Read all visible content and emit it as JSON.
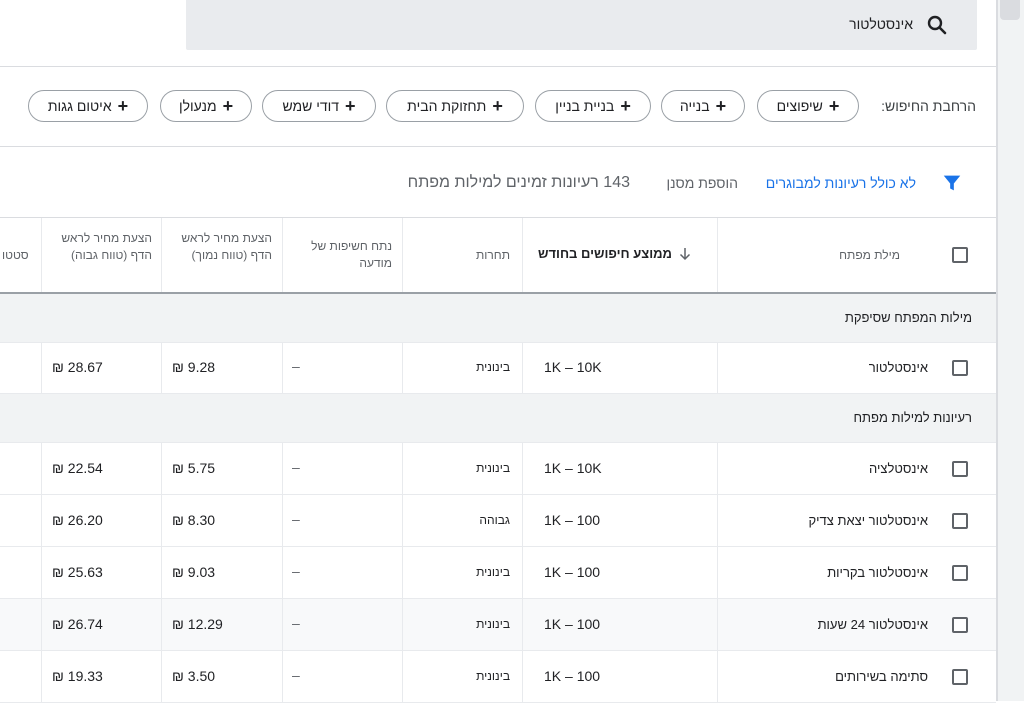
{
  "search": {
    "query": "אינסטלטור"
  },
  "expand": {
    "label": "הרחבת החיפוש:",
    "chips": [
      "שיפוצים",
      "בנייה",
      "בניית בניין",
      "תחזוקת הבית",
      "דודי שמש",
      "מנעולן",
      "איטום גגות"
    ]
  },
  "toolbar": {
    "filter_label": "לא כולל רעיונות למבוגרים",
    "add_filter": "הוספת מסנן",
    "ideas_count": "143 רעיונות זמינים למילות מפתח"
  },
  "columns": {
    "keyword": "מילת מפתח",
    "avg_searches": "ממוצע חיפושים בחודש",
    "competition": "תחרות",
    "impression_share": "נתח חשיפות של מודעה",
    "bid_low": "הצעת מחיר לראש הדף (טווח נמוך)",
    "bid_high": "הצעת מחיר לראש הדף (טווח גבוה)",
    "status_partial": "סטטו"
  },
  "groups": {
    "provided": "מילות המפתח שסיפקת",
    "ideas": "רעיונות למילות מפתח"
  },
  "rows": [
    {
      "keyword": "אינסטלטור",
      "volume": "1K – 10K",
      "competition": "בינונית",
      "share": "–",
      "bid_low": "₪ 9.28",
      "bid_high": "₪ 28.67"
    },
    {
      "keyword": "אינסטלציה",
      "volume": "1K – 10K",
      "competition": "בינונית",
      "share": "–",
      "bid_low": "₪ 5.75",
      "bid_high": "₪ 22.54"
    },
    {
      "keyword": "אינסטלטור יצאת צדיק",
      "volume": "1K – 100",
      "competition": "גבוהה",
      "share": "–",
      "bid_low": "₪ 8.30",
      "bid_high": "₪ 26.20"
    },
    {
      "keyword": "אינסטלטור בקריות",
      "volume": "1K – 100",
      "competition": "בינונית",
      "share": "–",
      "bid_low": "₪ 9.03",
      "bid_high": "₪ 25.63"
    },
    {
      "keyword": "אינסטלטור 24 שעות",
      "volume": "1K – 100",
      "competition": "בינונית",
      "share": "–",
      "bid_low": "₪ 12.29",
      "bid_high": "₪ 26.74"
    },
    {
      "keyword": "סתימה בשירותים",
      "volume": "1K – 100",
      "competition": "בינונית",
      "share": "–",
      "bid_low": "₪ 3.50",
      "bid_high": "₪ 19.33"
    }
  ]
}
